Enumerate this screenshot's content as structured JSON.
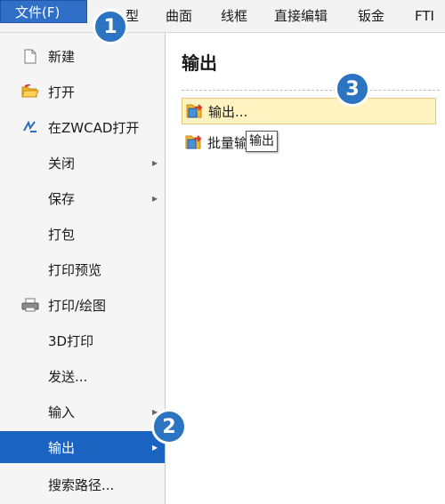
{
  "menubar": {
    "file_label": "文件(F)",
    "items": [
      "型",
      "曲面",
      "线框",
      "直接编辑",
      "钣金",
      "FTI"
    ]
  },
  "left_menu": {
    "items": [
      {
        "label": "新建",
        "icon": "new-file-icon",
        "has_submenu": false
      },
      {
        "label": "打开",
        "icon": "open-folder-icon",
        "has_submenu": false
      },
      {
        "label": "在ZWCAD打开",
        "icon": "zwcad-icon",
        "has_submenu": false
      },
      {
        "label": "关闭",
        "icon": "",
        "has_submenu": true
      },
      {
        "label": "保存",
        "icon": "",
        "has_submenu": true
      },
      {
        "label": "打包",
        "icon": "",
        "has_submenu": false
      },
      {
        "label": "打印预览",
        "icon": "",
        "has_submenu": false
      },
      {
        "label": "打印/绘图",
        "icon": "printer-icon",
        "has_submenu": false
      },
      {
        "label": "3D打印",
        "icon": "",
        "has_submenu": false
      },
      {
        "label": "发送...",
        "icon": "",
        "has_submenu": false
      },
      {
        "label": "输入",
        "icon": "",
        "has_submenu": true
      },
      {
        "label": "输出",
        "icon": "",
        "has_submenu": true,
        "active": true
      },
      {
        "label": "搜索路径...",
        "icon": "",
        "has_submenu": false
      }
    ]
  },
  "panel": {
    "title": "输出",
    "export_label": "输出...",
    "batch_label": "批量输",
    "tooltip": "输出"
  },
  "badges": [
    "1",
    "2",
    "3"
  ],
  "colors": {
    "accent": "#1b63c1",
    "badge": "#2a74c2",
    "highlight": "#fff3c2"
  }
}
